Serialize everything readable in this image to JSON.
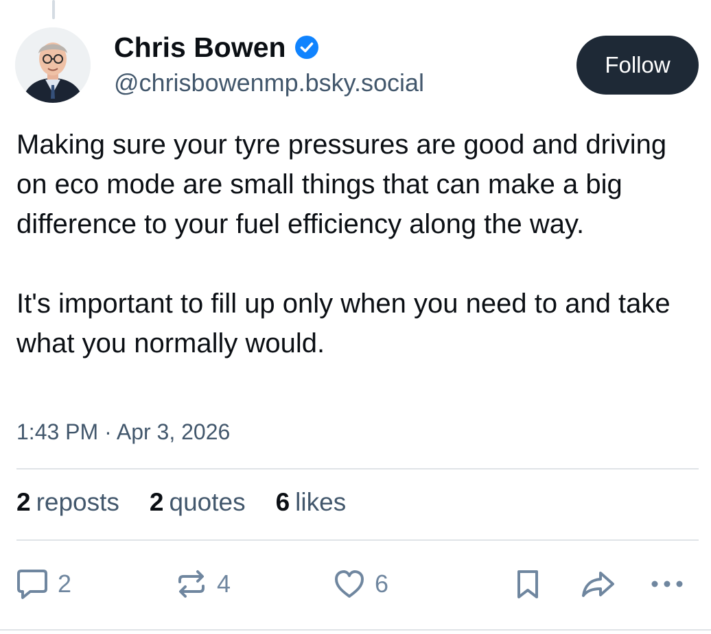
{
  "author": {
    "name": "Chris Bowen",
    "handle": "@chrisbowenmp.bsky.social",
    "verified_icon": "verified-badge-icon"
  },
  "follow_button": {
    "label": "Follow"
  },
  "post": {
    "paragraphs": [
      "Making sure your tyre pressures are good and driving on eco mode are small things that can make a big difference to your fuel efficiency along the way.",
      "It's important to fill up only when you need to and take what you normally would."
    ],
    "timestamp": "1:43 PM · Apr 3, 2026"
  },
  "stats": {
    "reposts": {
      "count": "2",
      "label": "reposts"
    },
    "quotes": {
      "count": "2",
      "label": "quotes"
    },
    "likes": {
      "count": "6",
      "label": "likes"
    }
  },
  "actions": {
    "reply": {
      "icon": "reply-bubble-icon",
      "count": "2"
    },
    "repost": {
      "icon": "repost-icon",
      "count": "4"
    },
    "like": {
      "icon": "heart-icon",
      "count": "6"
    },
    "bookmark": {
      "icon": "bookmark-icon"
    },
    "share": {
      "icon": "share-arrow-icon"
    },
    "more": {
      "icon": "more-dots-icon"
    }
  },
  "colors": {
    "text": "#0b0f14",
    "muted": "#42576c",
    "icon": "#6f869f",
    "follow_bg": "#1e2936",
    "verified": "#1083fe",
    "divider": "#dfe3e7"
  }
}
